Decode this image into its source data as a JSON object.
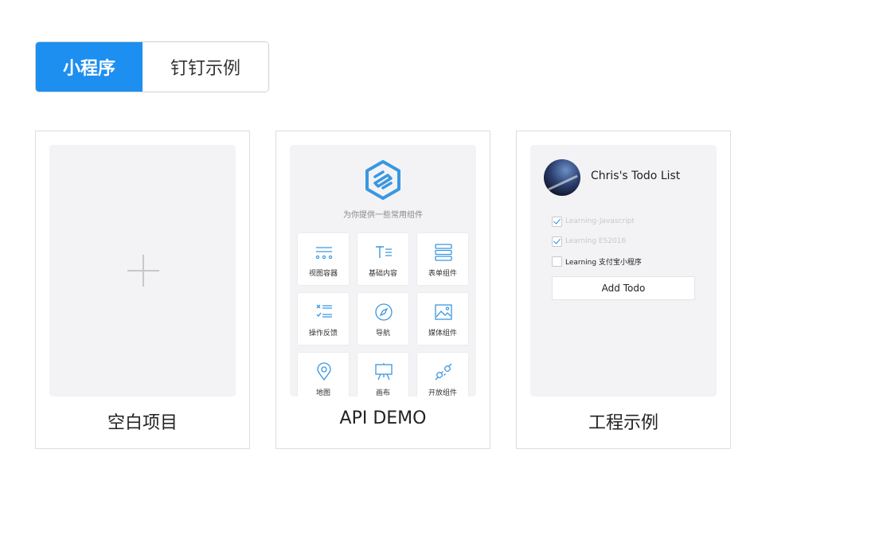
{
  "tabs": {
    "active": "小程序",
    "inactive": "钉钉示例"
  },
  "colors": {
    "accent": "#1d8ff0",
    "icon_blue": "#3a97e0"
  },
  "cards": {
    "blank": {
      "caption": "空白项目",
      "icon": "plus-icon"
    },
    "api": {
      "caption": "API DEMO",
      "logo": "mini-program-logo-icon",
      "subtitle": "为你提供一些常用组件",
      "tiles": [
        {
          "label": "视图容器",
          "icon": "view-container-icon"
        },
        {
          "label": "基础内容",
          "icon": "text-icon"
        },
        {
          "label": "表单组件",
          "icon": "form-icon"
        },
        {
          "label": "操作反馈",
          "icon": "feedback-icon"
        },
        {
          "label": "导航",
          "icon": "compass-icon"
        },
        {
          "label": "媒体组件",
          "icon": "image-icon"
        },
        {
          "label": "地图",
          "icon": "map-pin-icon"
        },
        {
          "label": "画布",
          "icon": "canvas-icon"
        },
        {
          "label": "开放组件",
          "icon": "plug-icon"
        }
      ]
    },
    "example": {
      "caption": "工程示例",
      "todo_title": "Chris's Todo List",
      "todos": [
        {
          "text": "Learning-Javascript",
          "checked": true
        },
        {
          "text": "Learning ES2016",
          "checked": true
        },
        {
          "text": "Learning 支付宝小程序",
          "checked": false
        }
      ],
      "add_label": "Add Todo"
    }
  }
}
